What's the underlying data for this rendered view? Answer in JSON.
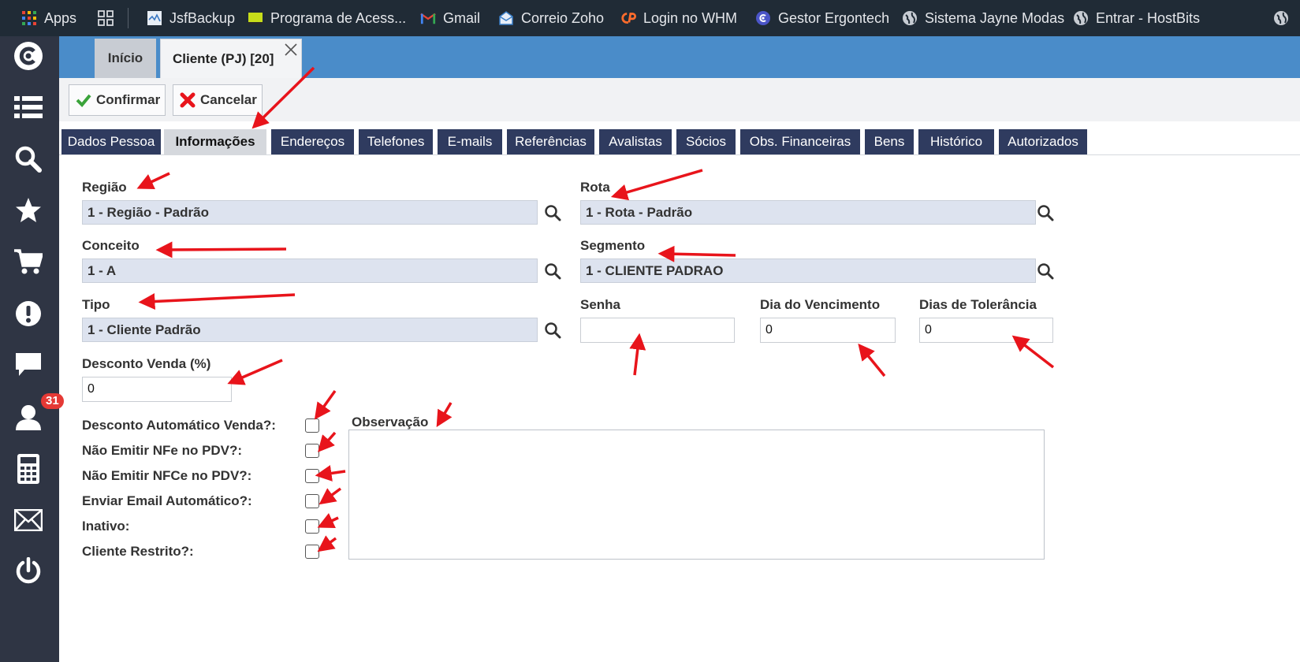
{
  "bookmarks": {
    "items": [
      {
        "label": "Apps",
        "icon": "apps-grid-icon"
      },
      {
        "label": "",
        "icon": "tab-groups-icon"
      },
      {
        "label": "JsfBackup",
        "icon": "jsfbackup-icon"
      },
      {
        "label": "Programa de Acess...",
        "icon": "yellow-square-icon"
      },
      {
        "label": "Gmail",
        "icon": "gmail-icon"
      },
      {
        "label": "Correio Zoho",
        "icon": "zoho-mail-icon"
      },
      {
        "label": "Login no WHM",
        "icon": "cpanel-icon"
      },
      {
        "label": "Gestor Ergontech",
        "icon": "ergontech-icon"
      },
      {
        "label": "Sistema Jayne Modas",
        "icon": "globe-icon"
      },
      {
        "label": "Entrar - HostBits",
        "icon": "globe-icon"
      }
    ]
  },
  "sidebar": {
    "badge_count": "31",
    "icons": [
      "logo-icon",
      "list-icon",
      "search-icon",
      "star-icon",
      "cart-icon",
      "alert-icon",
      "chat-icon",
      "user-icon",
      "calculator-icon",
      "mail-icon",
      "power-icon"
    ]
  },
  "window_tabs": {
    "home": "Início",
    "active": "Cliente (PJ) [20]"
  },
  "toolbar": {
    "confirm": "Confirmar",
    "cancel": "Cancelar"
  },
  "section_tabs": [
    {
      "label": "Dados Pessoa",
      "active": false
    },
    {
      "label": "Informações",
      "active": true
    },
    {
      "label": "Endereços",
      "active": false
    },
    {
      "label": "Telefones",
      "active": false
    },
    {
      "label": "E-mails",
      "active": false
    },
    {
      "label": "Referências",
      "active": false
    },
    {
      "label": "Avalistas",
      "active": false
    },
    {
      "label": "Sócios",
      "active": false
    },
    {
      "label": "Obs. Financeiras",
      "active": false
    },
    {
      "label": "Bens",
      "active": false
    },
    {
      "label": "Histórico",
      "active": false
    },
    {
      "label": "Autorizados",
      "active": false
    }
  ],
  "form": {
    "regiao": {
      "label": "Região",
      "value": "1 - Região - Padrão"
    },
    "rota": {
      "label": "Rota",
      "value": "1 - Rota - Padrão"
    },
    "conceito": {
      "label": "Conceito",
      "value": "1 - A"
    },
    "segmento": {
      "label": "Segmento",
      "value": "1 - CLIENTE PADRAO"
    },
    "tipo": {
      "label": "Tipo",
      "value": "1 - Cliente Padrão"
    },
    "senha": {
      "label": "Senha",
      "value": ""
    },
    "dia_vencimento": {
      "label": "Dia do Vencimento",
      "value": "0"
    },
    "dias_tolerancia": {
      "label": "Dias de Tolerância",
      "value": "0"
    },
    "desconto_venda": {
      "label": "Desconto Venda (%)",
      "value": "0"
    },
    "checkboxes": [
      {
        "label": "Desconto Automático Venda?:",
        "checked": false
      },
      {
        "label": "Não Emitir NFe no PDV?:",
        "checked": false
      },
      {
        "label": "Não Emitir NFCe no PDV?:",
        "checked": false
      },
      {
        "label": "Enviar Email Automático?:",
        "checked": false
      },
      {
        "label": "Inativo:",
        "checked": false
      },
      {
        "label": "Cliente Restrito?:",
        "checked": false
      }
    ],
    "observacao": {
      "label": "Observação",
      "value": ""
    }
  },
  "colors": {
    "header_blue": "#4a8cc9",
    "tab_navy": "#2f3b5f",
    "sidebar": "#2f3544",
    "lookup_bg": "#dde3ef",
    "annotation_red": "#e8141b"
  }
}
